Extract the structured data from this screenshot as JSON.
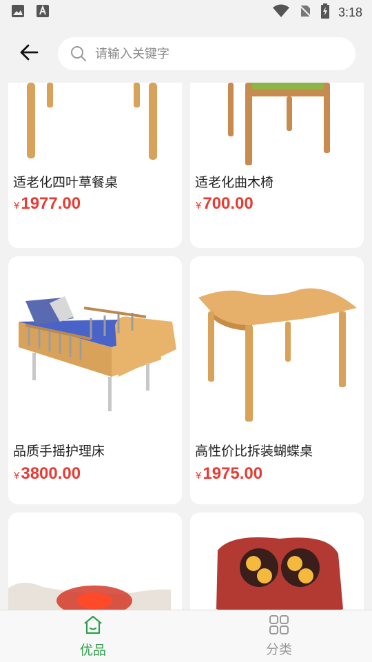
{
  "status_bar": {
    "time": "3:18",
    "left_icons": [
      "image-icon",
      "font-a-icon"
    ],
    "right_icons": [
      "wifi-icon",
      "no-sim-icon",
      "battery-icon"
    ]
  },
  "header": {
    "back_icon": "back-arrow-icon",
    "search": {
      "placeholder": "请输入关键字",
      "value": ""
    }
  },
  "products": [
    {
      "title": "适老化四叶草餐桌",
      "currency": "¥",
      "price": "1977.00",
      "image": "table-legs"
    },
    {
      "title": "适老化曲木椅",
      "currency": "¥",
      "price": "700.00",
      "image": "wooden-chair"
    },
    {
      "title": "品质手摇护理床",
      "currency": "¥",
      "price": "3800.00",
      "image": "nursing-bed"
    },
    {
      "title": "高性价比拆装蝴蝶桌",
      "currency": "¥",
      "price": "1975.00",
      "image": "butterfly-table"
    },
    {
      "title": "",
      "currency": "",
      "price": "",
      "image": "neck-massager"
    },
    {
      "title": "",
      "currency": "",
      "price": "",
      "image": "massage-cushion"
    }
  ],
  "tabs": [
    {
      "label": "优品",
      "icon": "home-icon",
      "active": true
    },
    {
      "label": "分类",
      "icon": "category-grid-icon",
      "active": false
    }
  ],
  "colors": {
    "accent": "#2e9e4b",
    "price": "#e73b33",
    "background": "#f2f2f2"
  }
}
